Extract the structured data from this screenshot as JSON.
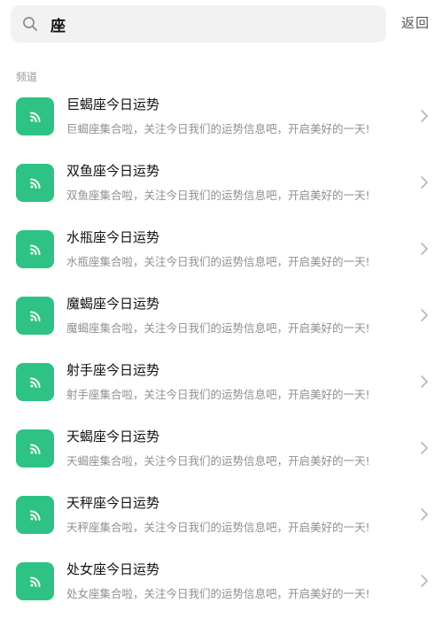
{
  "search": {
    "value": "座",
    "back_label": "返回"
  },
  "section": {
    "label": "频道"
  },
  "channels": [
    {
      "title": "巨蝎座今日运势",
      "subtitle": "巨蝎座集合啦，关注今日我们的运势信息吧，开启美好的一天!"
    },
    {
      "title": "双鱼座今日运势",
      "subtitle": "双鱼座集合啦，关注今日我们的运势信息吧，开启美好的一天!"
    },
    {
      "title": "水瓶座今日运势",
      "subtitle": "水瓶座集合啦，关注今日我们的运势信息吧，开启美好的一天!"
    },
    {
      "title": "魔蝎座今日运势",
      "subtitle": "魔蝎座集合啦，关注今日我们的运势信息吧，开启美好的一天!"
    },
    {
      "title": "射手座今日运势",
      "subtitle": "射手座集合啦，关注今日我们的运势信息吧，开启美好的一天!"
    },
    {
      "title": "天蝎座今日运势",
      "subtitle": "天蝎座集合啦，关注今日我们的运势信息吧，开启美好的一天!"
    },
    {
      "title": "天秤座今日运势",
      "subtitle": "天秤座集合啦，关注今日我们的运势信息吧，开启美好的一天!"
    },
    {
      "title": "处女座今日运势",
      "subtitle": "处女座集合啦，关注今日我们的运势信息吧，开启美好的一天!"
    }
  ],
  "colors": {
    "accent": "#2ec384",
    "search_bg": "#f2f2f2"
  },
  "icons": {
    "search": "search-icon",
    "channel": "rss-icon",
    "chevron": "chevron-right-icon"
  }
}
